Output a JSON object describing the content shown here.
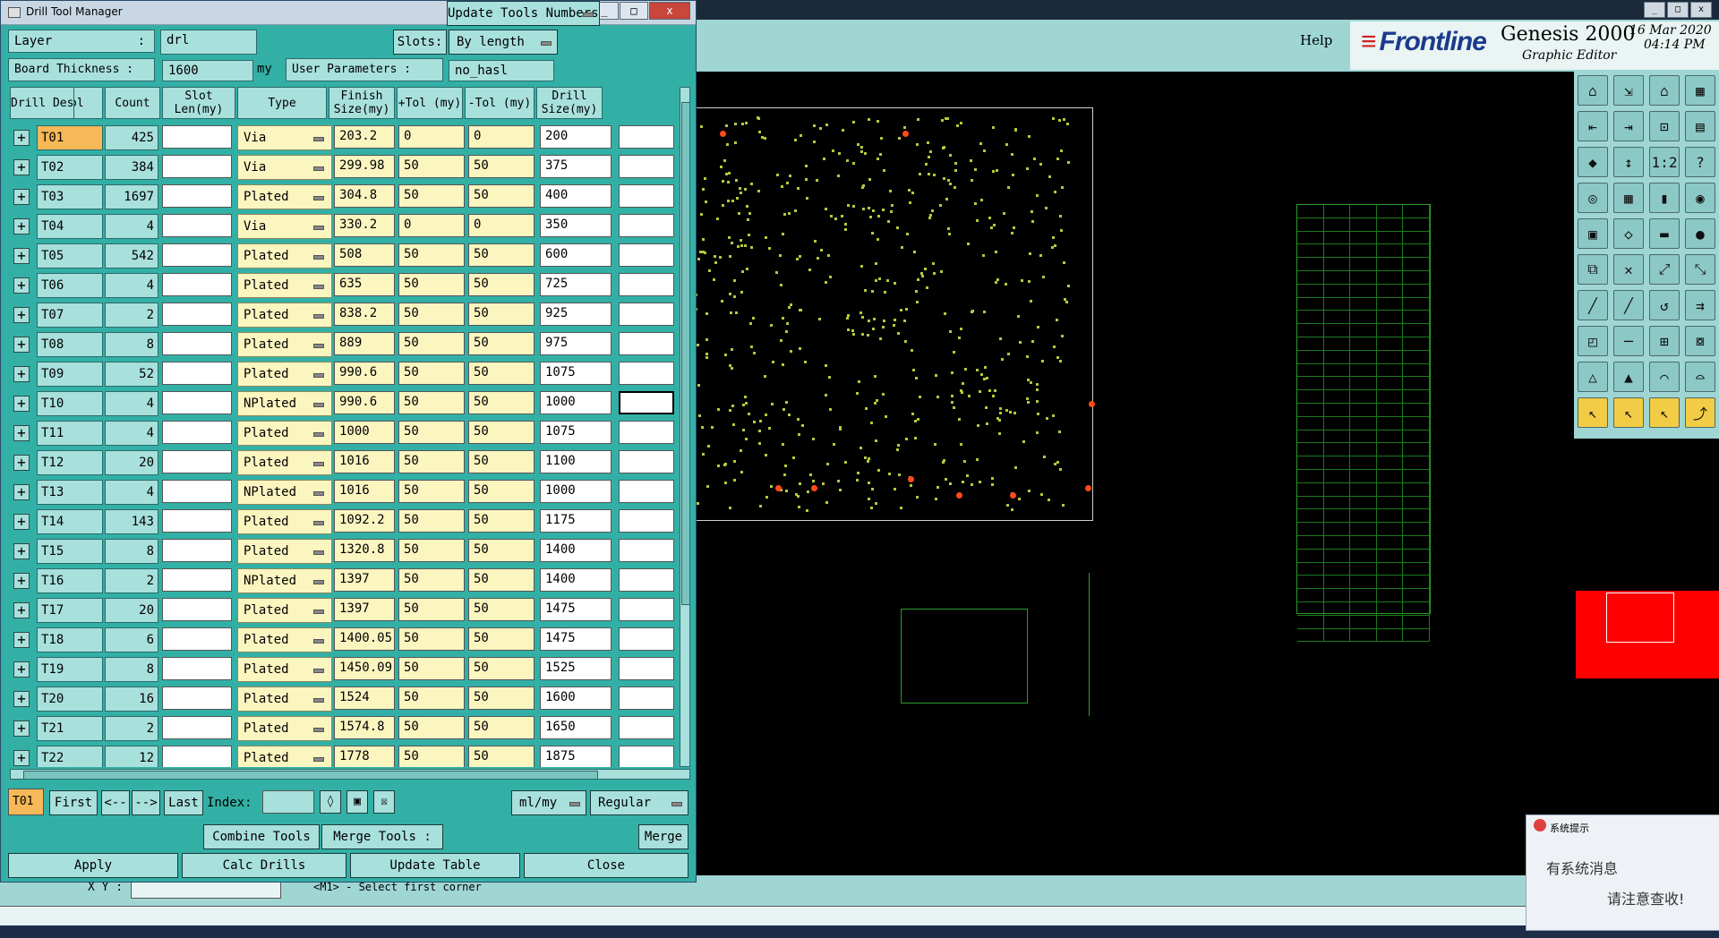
{
  "header": {
    "help": "Help",
    "logo": "Frontline",
    "product": "Genesis 2000",
    "subtitle": "Graphic Editor",
    "date": "16 Mar 2020",
    "time": "04:14 PM"
  },
  "dialog": {
    "title": "Drill Tool Manager",
    "layer_label": "Layer",
    "layer_value": "drl",
    "slots_label": "Slots:",
    "slots_value": "By length",
    "thickness_label": "Board Thickness :",
    "thickness_value": "1600",
    "thickness_unit": "my",
    "user_params_label": "User Parameters :",
    "user_params_value": "no_hasl",
    "columns": [
      "Tool",
      "Count",
      "Slot Len(my)",
      "Type",
      "Finish Size(my)",
      "+Tol (my)",
      "-Tol (my)",
      "Drill Size(my)",
      "Drill Des"
    ],
    "rows": [
      {
        "tool": "T01",
        "count": "425",
        "type": "Via",
        "finish": "203.2",
        "ptol": "0",
        "ntol": "0",
        "drill": "200"
      },
      {
        "tool": "T02",
        "count": "384",
        "type": "Via",
        "finish": "299.98",
        "ptol": "50",
        "ntol": "50",
        "drill": "375"
      },
      {
        "tool": "T03",
        "count": "1697",
        "type": "Plated",
        "finish": "304.8",
        "ptol": "50",
        "ntol": "50",
        "drill": "400"
      },
      {
        "tool": "T04",
        "count": "4",
        "type": "Via",
        "finish": "330.2",
        "ptol": "0",
        "ntol": "0",
        "drill": "350"
      },
      {
        "tool": "T05",
        "count": "542",
        "type": "Plated",
        "finish": "508",
        "ptol": "50",
        "ntol": "50",
        "drill": "600"
      },
      {
        "tool": "T06",
        "count": "4",
        "type": "Plated",
        "finish": "635",
        "ptol": "50",
        "ntol": "50",
        "drill": "725"
      },
      {
        "tool": "T07",
        "count": "2",
        "type": "Plated",
        "finish": "838.2",
        "ptol": "50",
        "ntol": "50",
        "drill": "925"
      },
      {
        "tool": "T08",
        "count": "8",
        "type": "Plated",
        "finish": "889",
        "ptol": "50",
        "ntol": "50",
        "drill": "975"
      },
      {
        "tool": "T09",
        "count": "52",
        "type": "Plated",
        "finish": "990.6",
        "ptol": "50",
        "ntol": "50",
        "drill": "1075"
      },
      {
        "tool": "T10",
        "count": "4",
        "type": "NPlated",
        "finish": "990.6",
        "ptol": "50",
        "ntol": "50",
        "drill": "1000"
      },
      {
        "tool": "T11",
        "count": "4",
        "type": "Plated",
        "finish": "1000",
        "ptol": "50",
        "ntol": "50",
        "drill": "1075"
      },
      {
        "tool": "T12",
        "count": "20",
        "type": "Plated",
        "finish": "1016",
        "ptol": "50",
        "ntol": "50",
        "drill": "1100"
      },
      {
        "tool": "T13",
        "count": "4",
        "type": "NPlated",
        "finish": "1016",
        "ptol": "50",
        "ntol": "50",
        "drill": "1000"
      },
      {
        "tool": "T14",
        "count": "143",
        "type": "Plated",
        "finish": "1092.2",
        "ptol": "50",
        "ntol": "50",
        "drill": "1175"
      },
      {
        "tool": "T15",
        "count": "8",
        "type": "Plated",
        "finish": "1320.8",
        "ptol": "50",
        "ntol": "50",
        "drill": "1400"
      },
      {
        "tool": "T16",
        "count": "2",
        "type": "NPlated",
        "finish": "1397",
        "ptol": "50",
        "ntol": "50",
        "drill": "1400"
      },
      {
        "tool": "T17",
        "count": "20",
        "type": "Plated",
        "finish": "1397",
        "ptol": "50",
        "ntol": "50",
        "drill": "1475"
      },
      {
        "tool": "T18",
        "count": "6",
        "type": "Plated",
        "finish": "1400.05",
        "ptol": "50",
        "ntol": "50",
        "drill": "1475"
      },
      {
        "tool": "T19",
        "count": "8",
        "type": "Plated",
        "finish": "1450.09",
        "ptol": "50",
        "ntol": "50",
        "drill": "1525"
      },
      {
        "tool": "T20",
        "count": "16",
        "type": "Plated",
        "finish": "1524",
        "ptol": "50",
        "ntol": "50",
        "drill": "1600"
      },
      {
        "tool": "T21",
        "count": "2",
        "type": "Plated",
        "finish": "1574.8",
        "ptol": "50",
        "ntol": "50",
        "drill": "1650"
      },
      {
        "tool": "T22",
        "count": "12",
        "type": "Plated",
        "finish": "1778",
        "ptol": "50",
        "ntol": "50",
        "drill": "1875"
      }
    ],
    "nav": {
      "current": "T01",
      "first": "First",
      "prev": "<--",
      "next": "-->",
      "last": "Last",
      "index_label": "Index:",
      "units": "ml/my",
      "mode": "Regular"
    },
    "actions": {
      "combine": "Combine Tools",
      "merge_label": "Merge Tools :",
      "update_numbers": "Update Tools Numbers",
      "merge": "Merge",
      "apply": "Apply",
      "calc": "Calc Drills",
      "update_table": "Update Table",
      "close": "Close"
    }
  },
  "status": {
    "xy_label": "X Y :",
    "message": "<M1> - Select first corner"
  },
  "notice": {
    "title": "系统提示",
    "line1": "有系统消息",
    "line2": "请注意查收!"
  }
}
